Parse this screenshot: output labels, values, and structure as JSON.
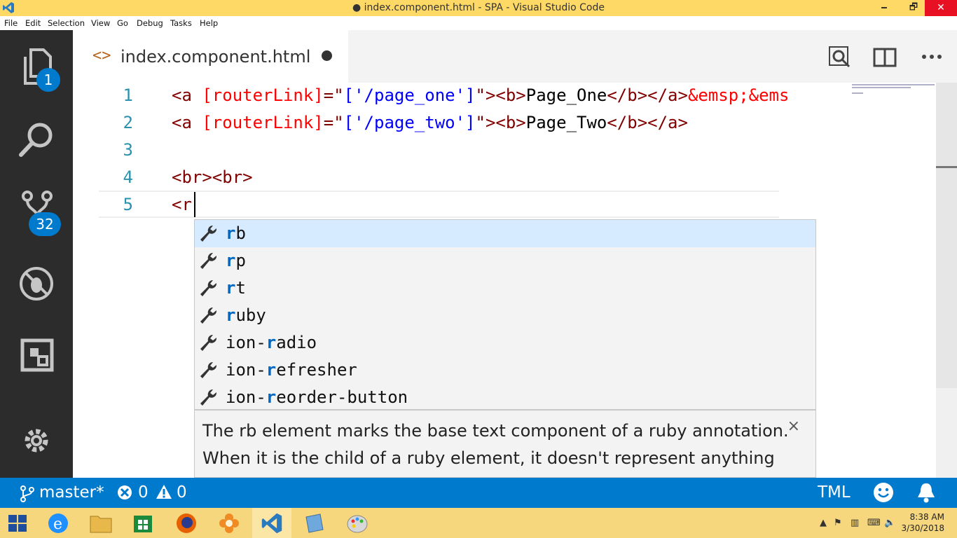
{
  "window": {
    "title": "● index.component.html - SPA - Visual Studio Code",
    "minimize": "🗕",
    "maximize": "🗗",
    "close": "✕"
  },
  "menu": [
    "File",
    "Edit",
    "Selection",
    "View",
    "Go",
    "Debug",
    "Tasks",
    "Help"
  ],
  "activity": {
    "explorer_badge": "1",
    "scm_badge": "32"
  },
  "tab": {
    "icon": "<>",
    "label": "index.component.html"
  },
  "editor": {
    "line_numbers": [
      "1",
      "2",
      "3",
      "4",
      "5"
    ],
    "line1": {
      "open": "<a ",
      "attr": "[routerLink]",
      "eq": "=\"",
      "str": "['/page_one']",
      "close": "\">",
      "b_open": "<b>",
      "text": "Page_One",
      "b_close": "</b></a>",
      "ent": "&emsp;&ems"
    },
    "line2": {
      "open": "<a ",
      "attr": "[routerLink]",
      "eq": "=\"",
      "str": "['/page_two']",
      "close": "\">",
      "b_open": "<b>",
      "text": "Page_Two",
      "b_close": "</b></a>"
    },
    "line4": "<br><br>",
    "line5": "<r"
  },
  "suggestions": [
    {
      "hl": "r",
      "rest": "b",
      "prefix": ""
    },
    {
      "hl": "r",
      "rest": "p",
      "prefix": ""
    },
    {
      "hl": "r",
      "rest": "t",
      "prefix": ""
    },
    {
      "hl": "r",
      "rest": "uby",
      "prefix": ""
    },
    {
      "hl": "r",
      "rest": "adio",
      "prefix": "ion-"
    },
    {
      "hl": "r",
      "rest": "efresher",
      "prefix": "ion-"
    },
    {
      "hl": "r",
      "rest": "eorder-button",
      "prefix": "ion-"
    }
  ],
  "details": {
    "text": "The rb element marks the base text component of a ruby annotation. When it is the child of a ruby element, it doesn't represent anything itself, but its parent ruby element uses it as part of determining what it represents.",
    "close": "×"
  },
  "statusbar": {
    "branch": "master*",
    "errors": "0",
    "warnings": "0",
    "language": "TML"
  },
  "clock": {
    "time": "8:38 AM",
    "date": "3/30/2018"
  },
  "colors": {
    "accent": "#007acc",
    "activity_bg": "#2c2c2c",
    "titlebar": "#ffd966",
    "taskbar": "#f7d77d"
  }
}
